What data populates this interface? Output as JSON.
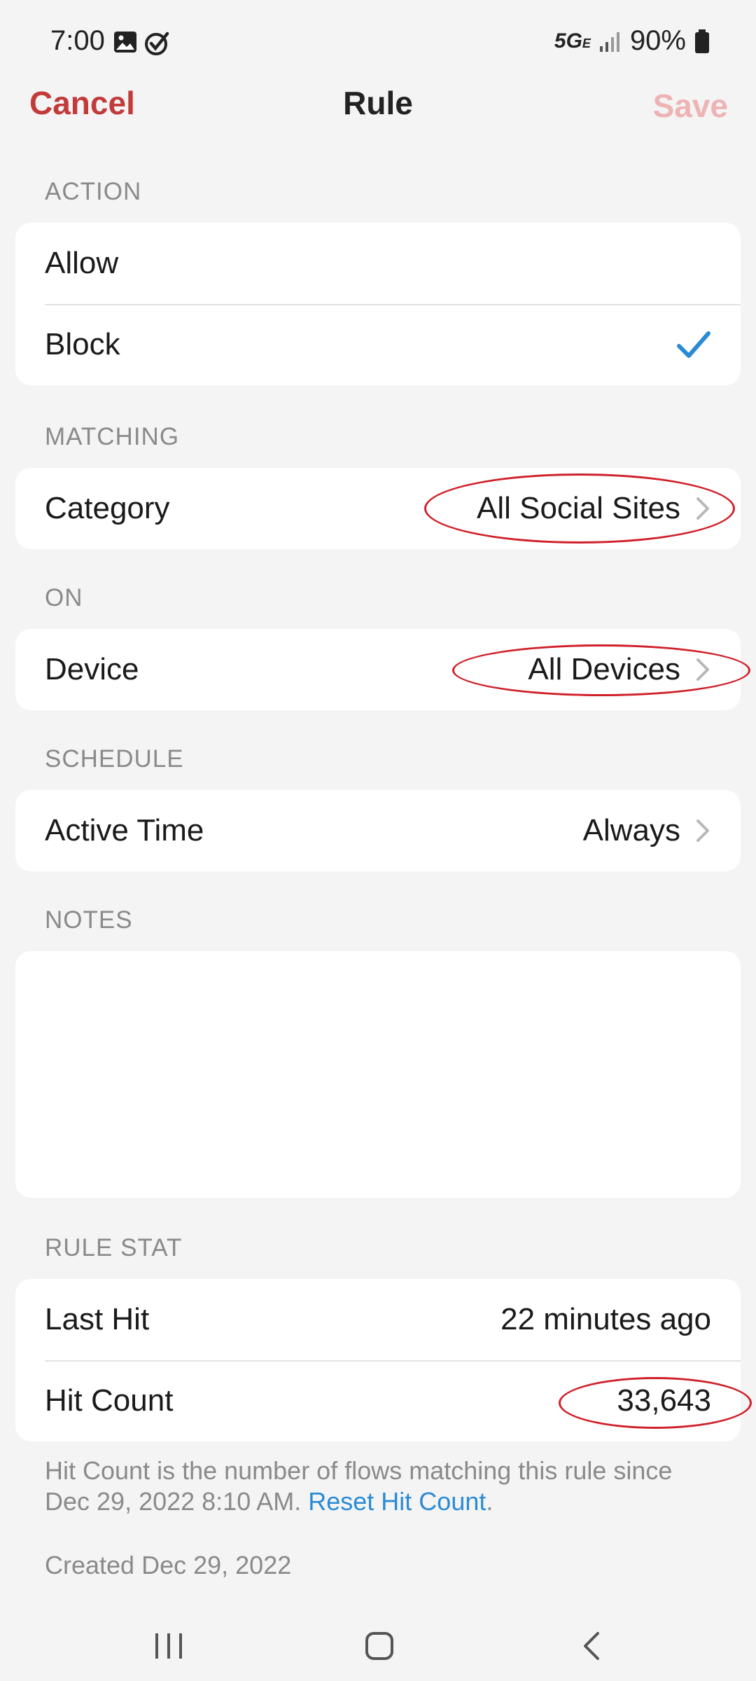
{
  "status_bar": {
    "time": "7:00",
    "network": "5G",
    "network_sub": "E",
    "battery": "90%"
  },
  "nav": {
    "cancel": "Cancel",
    "title": "Rule",
    "save": "Save"
  },
  "sections": {
    "action": {
      "header": "ACTION",
      "options": [
        {
          "label": "Allow",
          "selected": false
        },
        {
          "label": "Block",
          "selected": true
        }
      ]
    },
    "matching": {
      "header": "MATCHING",
      "category_label": "Category",
      "category_value": "All Social Sites"
    },
    "on": {
      "header": "ON",
      "device_label": "Device",
      "device_value": "All Devices"
    },
    "schedule": {
      "header": "SCHEDULE",
      "active_time_label": "Active Time",
      "active_time_value": "Always"
    },
    "notes": {
      "header": "NOTES",
      "value": ""
    },
    "rule_stat": {
      "header": "RULE STAT",
      "last_hit_label": "Last Hit",
      "last_hit_value": "22 minutes ago",
      "hit_count_label": "Hit Count",
      "hit_count_value": "33,643"
    }
  },
  "footnote": {
    "text": "Hit Count is the number of flows matching this rule since Dec 29, 2022 8:10 AM. ",
    "link": "Reset Hit Count",
    "end": "."
  },
  "created": "Created Dec 29, 2022",
  "colors": {
    "accent_red": "#c23b3b",
    "save_disabled": "#eeb4b4",
    "check_blue": "#2a8bd4",
    "annotation_red": "#d0202a"
  },
  "icons": [
    "gallery-icon",
    "check-circle-icon",
    "signal-icon",
    "battery-icon",
    "checkmark-icon",
    "chevron-right-icon",
    "recents-icon",
    "home-icon",
    "back-icon"
  ]
}
